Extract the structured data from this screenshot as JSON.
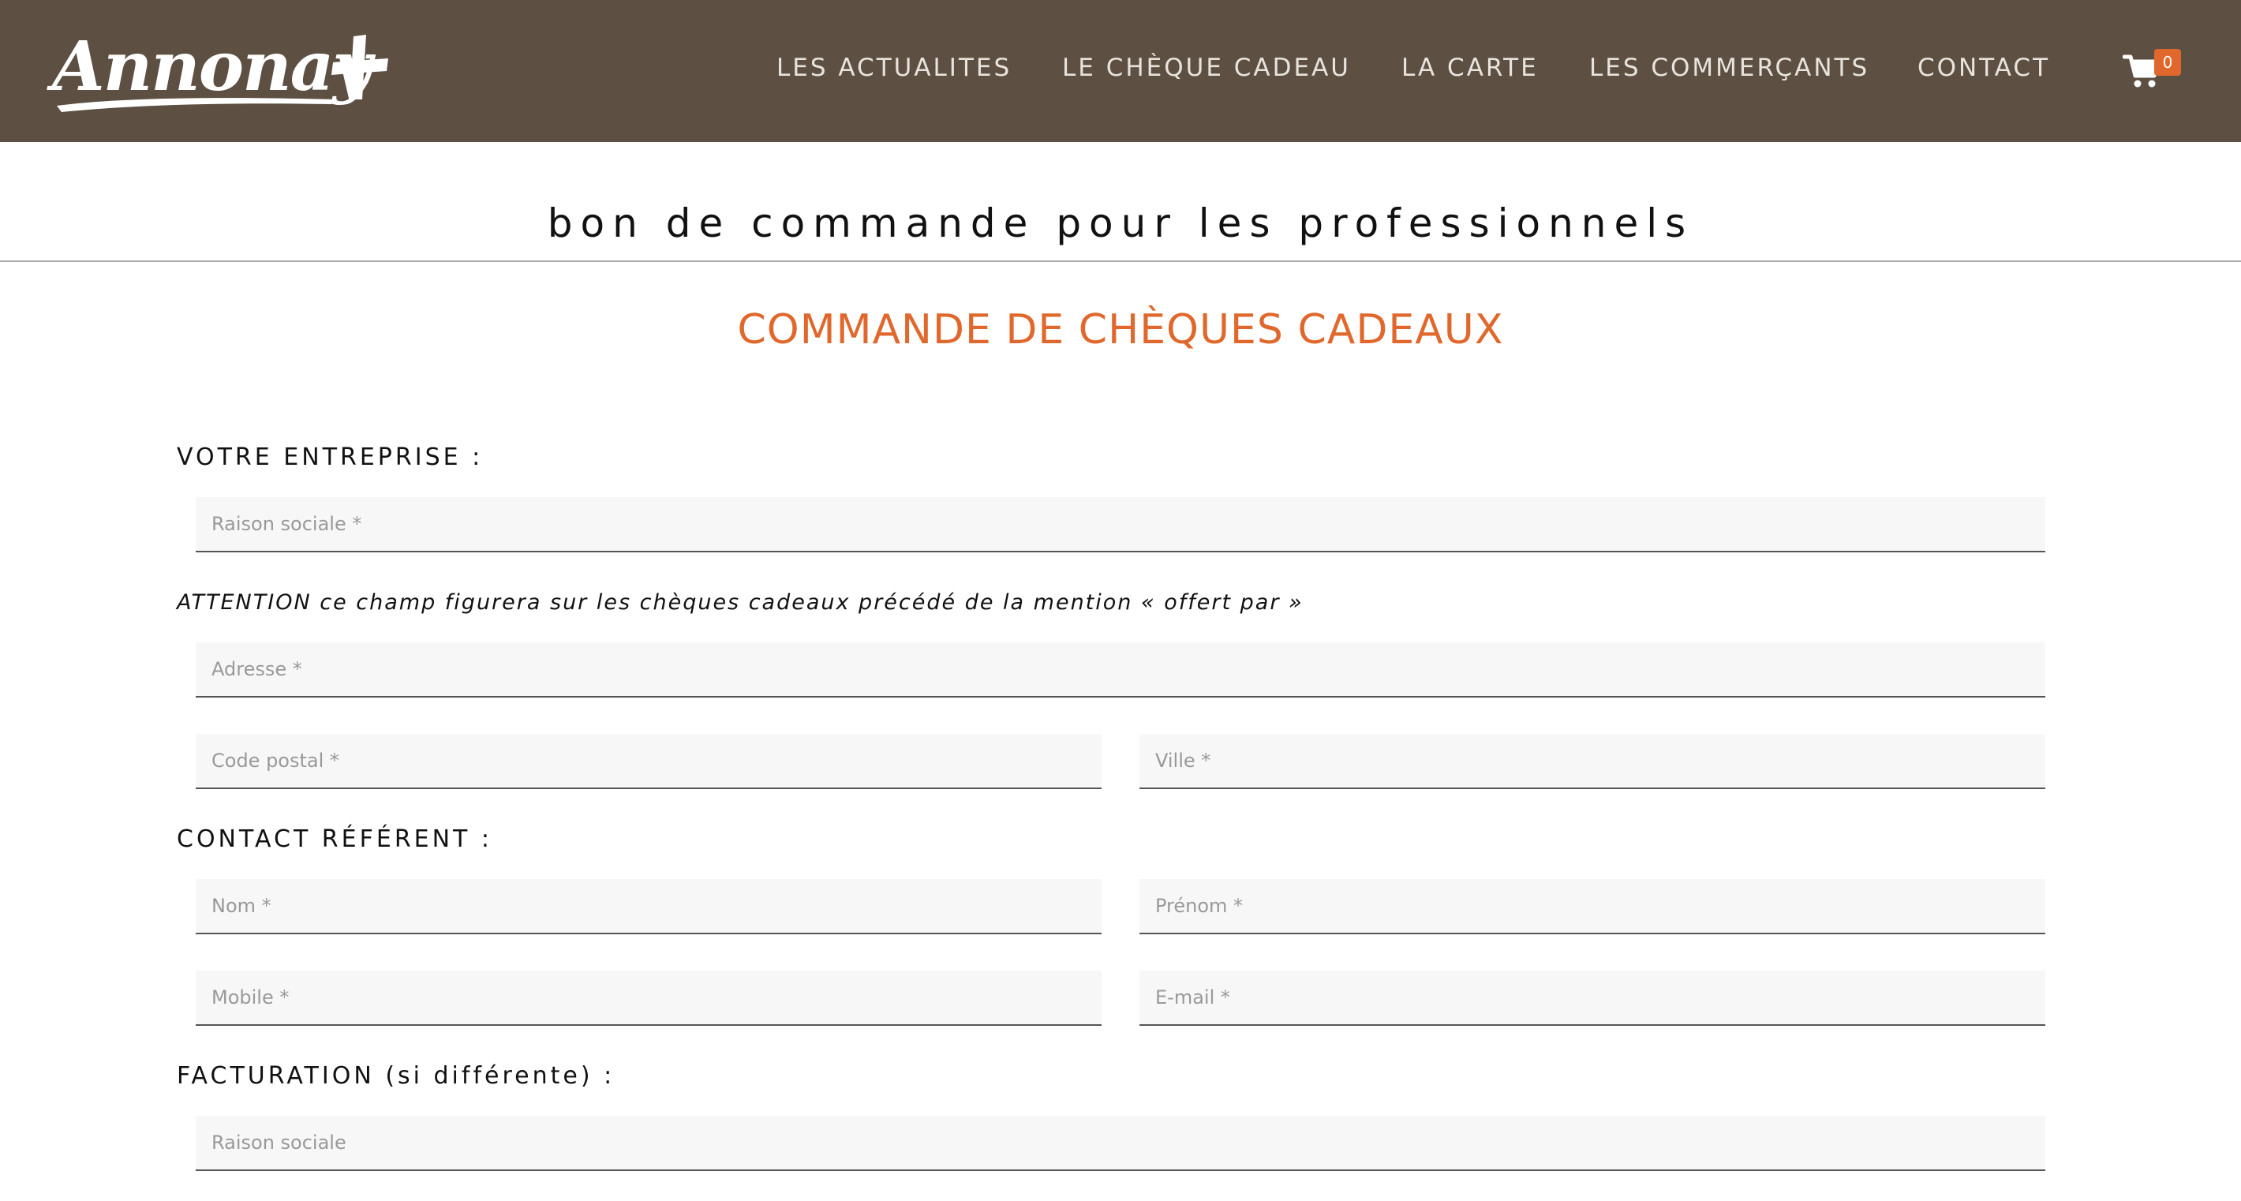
{
  "header": {
    "logo_text": "Annonay",
    "nav": [
      {
        "label": "LES ACTUALITES",
        "name": "nav-les-actualites"
      },
      {
        "label": "LE CHÈQUE CADEAU",
        "name": "nav-le-cheque-cadeau"
      },
      {
        "label": "LA CARTE",
        "name": "nav-la-carte"
      },
      {
        "label": "LES COMMERÇANTS",
        "name": "nav-les-commercants"
      },
      {
        "label": "CONTACT",
        "name": "nav-contact"
      }
    ],
    "cart_icon": "shopping-cart-icon",
    "cart_count": "0"
  },
  "page": {
    "title": "bon de commande pour les professionnels",
    "heading": "COMMANDE DE CHÈQUES CADEAUX"
  },
  "form": {
    "company_label": "VOTRE ENTREPRISE :",
    "company_name_placeholder": "Raison sociale *",
    "attention_note": "ATTENTION ce champ figurera sur les chèques cadeaux précédé de la mention « offert par »",
    "address_placeholder": "Adresse *",
    "postal_code_placeholder": "Code postal *",
    "city_placeholder": "Ville *",
    "contact_label": "CONTACT RÉFÉRENT :",
    "last_name_placeholder": "Nom *",
    "first_name_placeholder": "Prénom *",
    "mobile_placeholder": "Mobile *",
    "email_placeholder": "E-mail *",
    "billing_label": "FACTURATION (si différente) :",
    "billing_company_placeholder": "Raison sociale"
  },
  "colors": {
    "header_bg": "#5d5043",
    "accent": "#e0682c",
    "nav_text": "#e8e3dc"
  }
}
